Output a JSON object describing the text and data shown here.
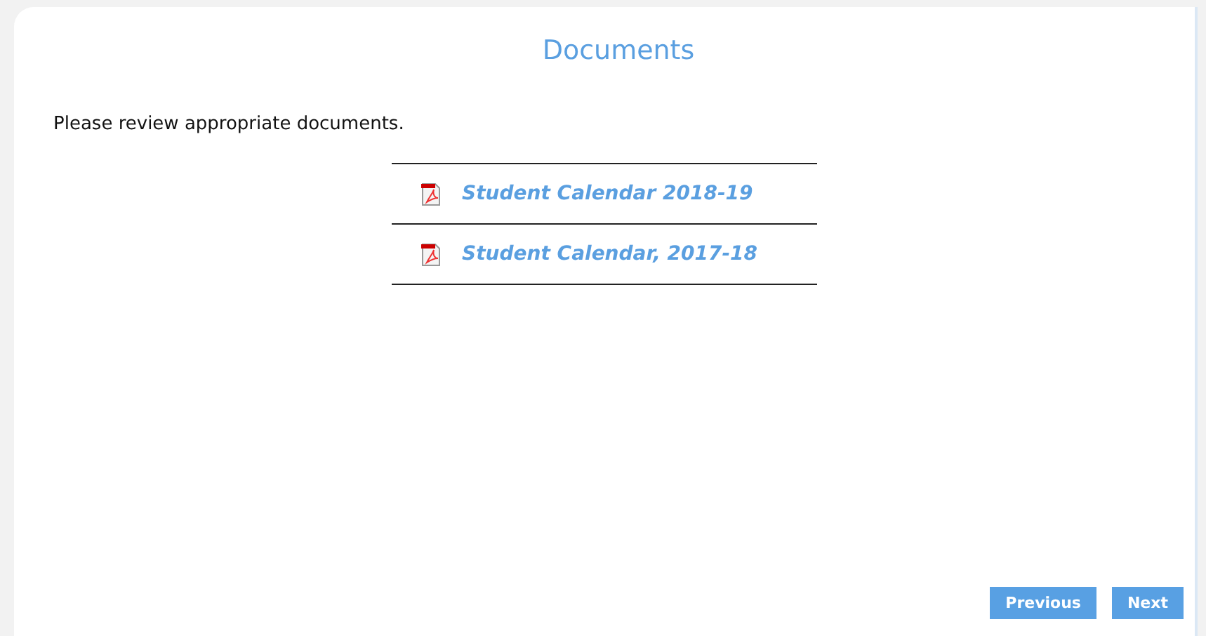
{
  "page": {
    "title": "Documents"
  },
  "intro": "Please review appropriate documents.",
  "documents": [
    {
      "label": "Student Calendar 2018-19"
    },
    {
      "label": "Student Calendar, 2017-18"
    }
  ],
  "buttons": [
    {
      "label": "Previous"
    },
    {
      "label": "Next"
    }
  ]
}
